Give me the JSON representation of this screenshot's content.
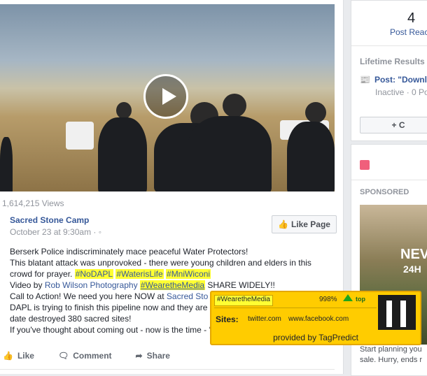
{
  "video": {
    "views": "1,614,215 Views"
  },
  "post": {
    "page_name": "Sacred Stone Camp",
    "time": "October 23 at 9:30am · ",
    "like_page": "Like Page",
    "line1": "Berserk Police indiscriminately mace peaceful Water Protectors!",
    "line2": "This blatant attack was unprovoked - there were young children and elders in this",
    "line3_pre": "crowd for prayer. ",
    "tags": [
      "#NoDAPL",
      "#WaterisLife",
      "#MniWiconi"
    ],
    "line4_pre": "Video by ",
    "line4_link": "Rob Wilson Photography",
    "line4_tag": "#WearetheMedia",
    "line4_post": " SHARE WIDELY!!",
    "line5_pre": "Call to Action! We need you here NOW at ",
    "line5_link": "Sacred Sto",
    "line6": "DAPL is trying to finish this pipeline now and they are",
    "line7": "date destroyed 380 sacred sites!",
    "line8": "If you've thought about coming out - now is the time - ‘"
  },
  "actions": {
    "like": "Like",
    "comment": "Comment",
    "share": "Share"
  },
  "sidebar": {
    "count": "4",
    "post_reach": "Post Reac",
    "lifetime": "Lifetime Results",
    "post_title": "Post: \"Downl",
    "post_status": "Inactive · 0 Po",
    "button": "+ C",
    "sponsored": "SPONSORED",
    "ad_text1": "NEV",
    "ad_text2": "24H",
    "ad_caption1": "Start planning you",
    "ad_caption2": "sale. Hurry, ends r"
  },
  "tagpredict": {
    "tag": "#WearetheMedia",
    "percent": "998%",
    "top": "top",
    "sites_label": "Sites:",
    "site1": "twitter.com",
    "site2": "www.facebook.com",
    "footer": "provided by TagPredict"
  }
}
